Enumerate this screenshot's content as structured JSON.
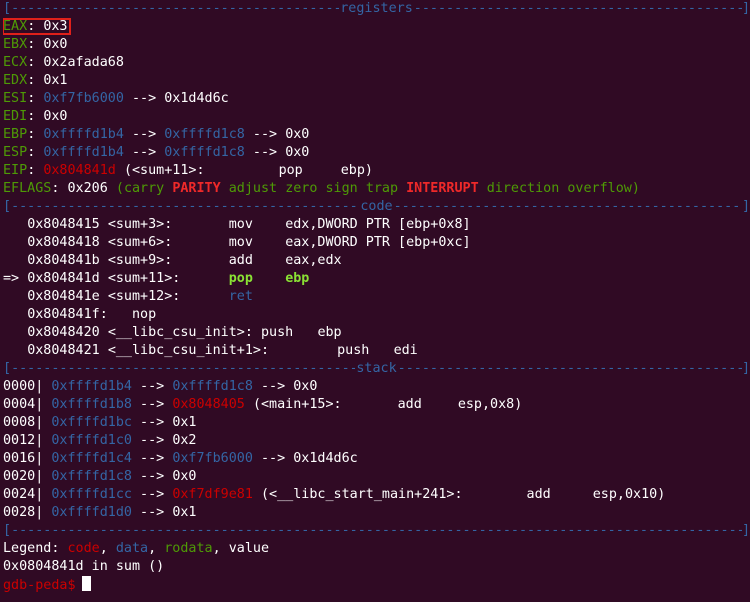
{
  "separators": {
    "registers": "registers",
    "code": "code",
    "stack": "stack"
  },
  "registers": [
    {
      "name": "EAX",
      "v1": "0x3",
      "v1c": "w"
    },
    {
      "name": "EBX",
      "v1": "0x0",
      "v1c": "w"
    },
    {
      "name": "ECX",
      "v1": "0x2afada68",
      "v1c": "w"
    },
    {
      "name": "EDX",
      "v1": "0x1",
      "v1c": "w"
    },
    {
      "name": "ESI",
      "v1": "0xf7fb6000",
      "v1c": "b",
      "v2": "0x1d4d6c",
      "v2c": "w"
    },
    {
      "name": "EDI",
      "v1": "0x0",
      "v1c": "w"
    },
    {
      "name": "EBP",
      "v1": "0xffffd1b4",
      "v1c": "b",
      "v2": "0xffffd1c8",
      "v2c": "b",
      "v3": "0x0",
      "v3c": "w"
    },
    {
      "name": "ESP",
      "v1": "0xffffd1b4",
      "v1c": "b",
      "v2": "0xffffd1c8",
      "v2c": "b",
      "v3": "0x0",
      "v3c": "w"
    },
    {
      "name": "EIP",
      "v1": "0x804841d",
      "v1c": "r",
      "sym": "(<sum+11>:",
      "mn": "pop",
      "op": "ebp)"
    }
  ],
  "eflags": {
    "name": "EFLAGS",
    "value": "0x206",
    "open": "(",
    "close": ")",
    "flags": [
      {
        "t": "carry",
        "on": false
      },
      {
        "t": "PARITY",
        "on": true
      },
      {
        "t": "adjust",
        "on": false
      },
      {
        "t": "zero",
        "on": false
      },
      {
        "t": "sign",
        "on": false
      },
      {
        "t": "trap",
        "on": false
      },
      {
        "t": "INTERRUPT",
        "on": true
      },
      {
        "t": "direction",
        "on": false
      },
      {
        "t": "overflow",
        "on": false
      }
    ]
  },
  "code": [
    {
      "addr": "0x8048415",
      "sym": "<sum+3>:",
      "mn": "mov",
      "op": "edx,DWORD PTR [ebp+0x8]",
      "cur": false
    },
    {
      "addr": "0x8048418",
      "sym": "<sum+6>:",
      "mn": "mov",
      "op": "eax,DWORD PTR [ebp+0xc]",
      "cur": false
    },
    {
      "addr": "0x804841b",
      "sym": "<sum+9>:",
      "mn": "add",
      "op": "eax,edx",
      "cur": false
    },
    {
      "addr": "0x804841d",
      "sym": "<sum+11>:",
      "mn": "pop",
      "op": "ebp",
      "cur": true
    },
    {
      "addr": "0x804841e",
      "sym": "<sum+12>:",
      "mn": "ret",
      "op": "",
      "cur": false
    },
    {
      "addr": "0x804841f:",
      "sym": "",
      "mn": "nop",
      "op": "",
      "cur": false
    },
    {
      "addr": "0x8048420",
      "sym": "<__libc_csu_init>:",
      "mn": "push",
      "op": "ebp",
      "cur": false
    },
    {
      "addr": "0x8048421",
      "sym": "<__libc_csu_init+1>:",
      "mn": "push",
      "op": "edi",
      "cur": false
    }
  ],
  "arrow": "=>",
  "stack": [
    {
      "off": "0000|",
      "a": "0xffffd1b4",
      "b": "0xffffd1c8",
      "bc": "b",
      "c": "0x0"
    },
    {
      "off": "0004|",
      "a": "0xffffd1b8",
      "b": "0x8048405",
      "bc": "r",
      "sym": "(<main+15>:",
      "mn": "add",
      "op": "esp,0x8)"
    },
    {
      "off": "0008|",
      "a": "0xffffd1bc",
      "b": "0x1",
      "bc": "w"
    },
    {
      "off": "0012|",
      "a": "0xffffd1c0",
      "b": "0x2",
      "bc": "w"
    },
    {
      "off": "0016|",
      "a": "0xffffd1c4",
      "b": "0xf7fb6000",
      "bc": "b",
      "c": "0x1d4d6c"
    },
    {
      "off": "0020|",
      "a": "0xffffd1c8",
      "b": "0x0",
      "bc": "w"
    },
    {
      "off": "0024|",
      "a": "0xffffd1cc",
      "b": "0xf7df9e81",
      "bc": "r",
      "sym": "(<__libc_start_main+241>:",
      "mn": "add",
      "op": "esp,0x10)"
    },
    {
      "off": "0028|",
      "a": "0xffffd1d0",
      "b": "0x1",
      "bc": "w"
    }
  ],
  "legend": {
    "label": "Legend:",
    "code": "code",
    "data": "data",
    "rodata": "rodata",
    "value": "value"
  },
  "status": "0x0804841d in sum ()",
  "prompt": "gdb-peda$",
  "colors": {
    "bg": "#300a24",
    "blue": "#3465a4",
    "green": "#4e9a06",
    "red": "#cc0000",
    "bright_green": "#8ae234",
    "highlight_box": "#e0201a"
  }
}
